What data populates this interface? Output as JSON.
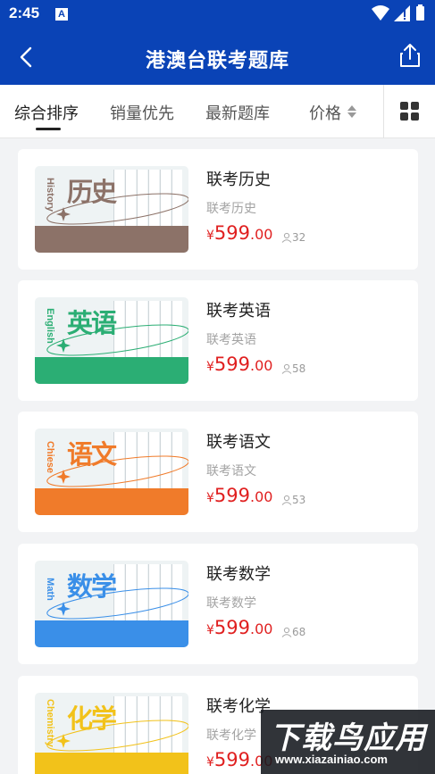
{
  "status_bar": {
    "time": "2:45",
    "notif_letter": "A"
  },
  "header": {
    "title": "港澳台联考题库"
  },
  "tabs": [
    {
      "label": "综合排序",
      "active": true
    },
    {
      "label": "销量优先",
      "active": false
    },
    {
      "label": "最新题库",
      "active": false
    },
    {
      "label": "价格",
      "active": false
    }
  ],
  "products": [
    {
      "title": "联考历史",
      "subtitle": "联考历史",
      "yen": "¥",
      "price_int": "599",
      "price_dec": ".00",
      "sales": "32",
      "cover_cn": "历史",
      "cover_en": "History",
      "accent": "#8c7268"
    },
    {
      "title": "联考英语",
      "subtitle": "联考英语",
      "yen": "¥",
      "price_int": "599",
      "price_dec": ".00",
      "sales": "58",
      "cover_cn": "英语",
      "cover_en": "English",
      "accent": "#2bae74"
    },
    {
      "title": "联考语文",
      "subtitle": "联考语文",
      "yen": "¥",
      "price_int": "599",
      "price_dec": ".00",
      "sales": "53",
      "cover_cn": "语文",
      "cover_en": "Chiese",
      "accent": "#f07b2a"
    },
    {
      "title": "联考数学",
      "subtitle": "联考数学",
      "yen": "¥",
      "price_int": "599",
      "price_dec": ".00",
      "sales": "68",
      "cover_cn": "数学",
      "cover_en": "Math",
      "accent": "#3a8fe8"
    },
    {
      "title": "联考化学",
      "subtitle": "联考化学",
      "yen": "¥",
      "price_int": "599",
      "price_dec": ".00",
      "sales": "",
      "cover_cn": "化学",
      "cover_en": "Chemistry",
      "accent": "#f2c21a"
    }
  ],
  "watermark": {
    "line1": "下载鸟应用",
    "line2": "www.xiazainiao.com"
  },
  "colors": {
    "brand": "#0a43b6",
    "price": "#e02020"
  }
}
